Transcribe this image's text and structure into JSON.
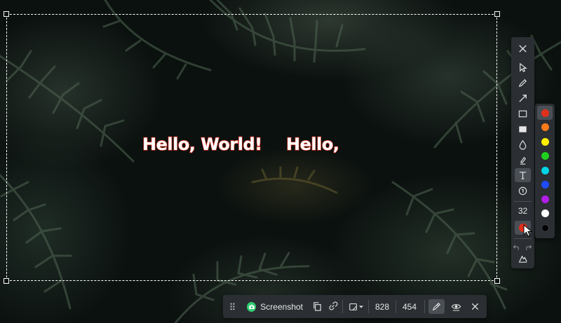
{
  "canvas": {
    "annotations": [
      {
        "text": "Hello, World!",
        "color": "#e2301c"
      },
      {
        "text": "Hello,",
        "color": "#e2301c"
      }
    ]
  },
  "toolbar": {
    "tools": [
      "close-icon",
      "select-pointer-icon",
      "pencil-icon",
      "arrow-icon",
      "rectangle-outline-icon",
      "rectangle-filled-icon",
      "blur-drop-icon",
      "highlighter-icon",
      "text-icon",
      "number-stamp-icon"
    ],
    "active_tool": "text-icon",
    "font_size": "32",
    "current_color": "#e2301c",
    "history": [
      "undo-icon",
      "redo-icon"
    ],
    "extra": "ocr-icon"
  },
  "palette": {
    "colors": [
      "#e2301c",
      "#ff7a1a",
      "#ffee00",
      "#1fd11f",
      "#00d3e6",
      "#1f4cff",
      "#b01fe8",
      "#ffffff",
      "#000000"
    ],
    "selected_index": 0
  },
  "bottom_bar": {
    "screenshot_label": "Screenshot",
    "width": "828",
    "height": "454"
  }
}
